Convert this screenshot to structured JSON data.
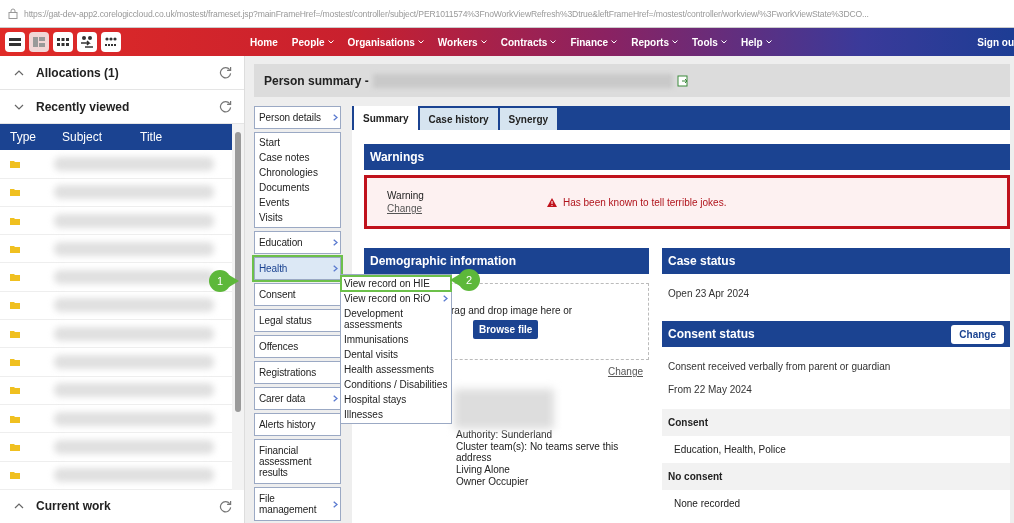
{
  "address_bar": {
    "url": "https://gat-dev-app2.corelogiccloud.co.uk/mostest/frameset.jsp?mainFrameHref=/mostest/controller/subject/PER1011574%3FnoWorkViewRefresh%3Dtrue&leftFrameHref=/mostest/controller/workview/%3FworkViewState%3DCO..."
  },
  "nav": {
    "items": [
      {
        "label": "Home",
        "dropdown": false
      },
      {
        "label": "People",
        "dropdown": true
      },
      {
        "label": "Organisations",
        "dropdown": true
      },
      {
        "label": "Workers",
        "dropdown": true
      },
      {
        "label": "Contracts",
        "dropdown": true
      },
      {
        "label": "Finance",
        "dropdown": true
      },
      {
        "label": "Reports",
        "dropdown": true
      },
      {
        "label": "Tools",
        "dropdown": true
      },
      {
        "label": "Help",
        "dropdown": true
      }
    ],
    "sign_out": "Sign ou"
  },
  "sidebar": {
    "sections": [
      {
        "title": "Allocations (1)",
        "expanded": false
      },
      {
        "title": "Recently viewed",
        "expanded": true
      }
    ],
    "columns": [
      "Type",
      "Subject",
      "Title"
    ],
    "rows": [
      {
        "redacted": true
      },
      {
        "redacted": true
      },
      {
        "redacted": true
      },
      {
        "redacted": true
      },
      {
        "redacted": true
      },
      {
        "redacted": true
      },
      {
        "redacted": true
      },
      {
        "redacted": true
      },
      {
        "redacted": true
      },
      {
        "redacted": true
      },
      {
        "redacted": true
      },
      {
        "redacted": true
      }
    ],
    "footer": {
      "title": "Current work",
      "expanded": false
    }
  },
  "person_summary": {
    "title": "Person summary -",
    "name_redacted": true
  },
  "side_menu": [
    {
      "kind": "box",
      "label": "Person details",
      "submenu": true,
      "selected": false
    },
    {
      "kind": "link",
      "label": "Start",
      "selected": false
    },
    {
      "kind": "link",
      "label": "Case notes",
      "selected": false
    },
    {
      "kind": "link",
      "label": "Chronologies",
      "selected": false
    },
    {
      "kind": "link",
      "label": "Documents",
      "selected": false
    },
    {
      "kind": "link",
      "label": "Events",
      "selected": false
    },
    {
      "kind": "link",
      "label": "Visits",
      "selected": false
    },
    {
      "kind": "box",
      "label": "Education",
      "submenu": true,
      "selected": false
    },
    {
      "kind": "box",
      "label": "Health",
      "submenu": true,
      "selected": true
    },
    {
      "kind": "box",
      "label": "Consent",
      "submenu": false,
      "selected": false
    },
    {
      "kind": "box",
      "label": "Legal status",
      "submenu": false,
      "selected": false
    },
    {
      "kind": "box",
      "label": "Offences",
      "submenu": false,
      "selected": false
    },
    {
      "kind": "box",
      "label": "Registrations",
      "submenu": false,
      "selected": false
    },
    {
      "kind": "box",
      "label": "Carer data",
      "submenu": true,
      "selected": false
    },
    {
      "kind": "box",
      "label": "Alerts history",
      "submenu": false,
      "selected": false
    },
    {
      "kind": "box",
      "label": "Financial assessment results",
      "submenu": false,
      "selected": false
    },
    {
      "kind": "box",
      "label": "File management",
      "submenu": true,
      "selected": false
    }
  ],
  "submenu": [
    {
      "label": "View record on HIE",
      "submenu": false,
      "selected": true
    },
    {
      "label": "View record on RiO",
      "submenu": true,
      "selected": false
    },
    {
      "label": "Development assessments",
      "submenu": false,
      "selected": false
    },
    {
      "label": "Immunisations",
      "submenu": false,
      "selected": false
    },
    {
      "label": "Dental visits",
      "submenu": false,
      "selected": false
    },
    {
      "label": "Health assessments",
      "submenu": false,
      "selected": false
    },
    {
      "label": "Conditions / Disabilities",
      "submenu": false,
      "selected": false
    },
    {
      "label": "Hospital stays",
      "submenu": false,
      "selected": false
    },
    {
      "label": "Illnesses",
      "submenu": false,
      "selected": false
    }
  ],
  "callouts": [
    {
      "label": "1"
    },
    {
      "label": "2"
    }
  ],
  "tabs": [
    {
      "label": "Summary",
      "selected": true
    },
    {
      "label": "Case history",
      "selected": false
    },
    {
      "label": "Synergy",
      "selected": false
    }
  ],
  "warnings": {
    "title": "Warnings",
    "label": "Warning",
    "change": "Change",
    "message": "Has been known to tell terrible jokes."
  },
  "demographic": {
    "title": "Demographic information",
    "drop_hint": "rag and drop image here or",
    "browse": "Browse file",
    "change": "Change",
    "photo_redacted": true,
    "details": [
      "Authority: Sunderland",
      "Cluster team(s): No teams serve this address",
      "Living Alone",
      "Owner Occupier"
    ]
  },
  "case_status": {
    "title": "Case status",
    "text": "Open 23 Apr 2024"
  },
  "consent_status": {
    "title": "Consent status",
    "change": "Change",
    "description": "Consent received verbally from parent or guardian",
    "from": "From 22 May 2024",
    "groups": [
      {
        "heading": "Consent",
        "value": "Education, Health, Police"
      },
      {
        "heading": "No consent",
        "value": "None recorded"
      }
    ]
  }
}
